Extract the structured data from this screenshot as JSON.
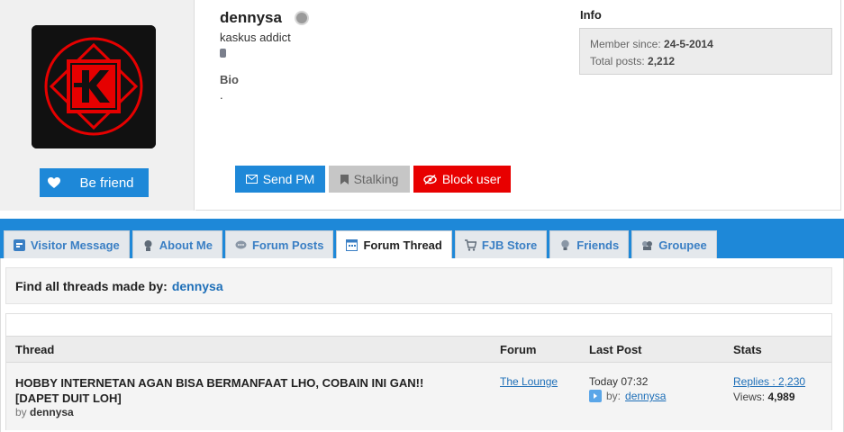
{
  "profile": {
    "username": "dennysa",
    "rank": "kaskus addict",
    "bio_title": "Bio",
    "bio_text": ".",
    "friend_button": "Be friend",
    "info": {
      "title": "Info",
      "member_since_label": "Member since:",
      "member_since_value": "24-5-2014",
      "total_posts_label": "Total posts:",
      "total_posts_value": "2,212"
    },
    "actions": {
      "send_pm": "Send PM",
      "stalking": "Stalking",
      "block_user": "Block user"
    }
  },
  "tabs": [
    {
      "label": "Visitor Message",
      "icon": "message-board-icon"
    },
    {
      "label": "About Me",
      "icon": "user-info-icon"
    },
    {
      "label": "Forum Posts",
      "icon": "speech-bubble-icon"
    },
    {
      "label": "Forum Thread",
      "icon": "thread-window-icon",
      "active": true
    },
    {
      "label": "FJB Store",
      "icon": "shopping-cart-icon"
    },
    {
      "label": "Friends",
      "icon": "bulb-icon"
    },
    {
      "label": "Groupee",
      "icon": "group-icon"
    }
  ],
  "find": {
    "label": "Find all threads made by:",
    "user": "dennysa"
  },
  "table": {
    "headers": {
      "thread": "Thread",
      "forum": "Forum",
      "last_post": "Last Post",
      "stats": "Stats"
    },
    "rows": [
      {
        "title": "HOBBY INTERNETAN AGAN BISA BERMANFAAT LHO, COBAIN INI GAN!! [DAPET DUIT LOH]",
        "by_label": "by",
        "by_user": "dennysa",
        "forum": "The Lounge",
        "last_time": "Today 07:32",
        "last_by_label": "by:",
        "last_by_user": "dennysa",
        "replies": "Replies : 2,230",
        "views_label": "Views:",
        "views_value": "4,989"
      }
    ]
  },
  "colors": {
    "brand": "#1e88d8",
    "block": "#e80000",
    "avatar_red": "#e60000"
  }
}
